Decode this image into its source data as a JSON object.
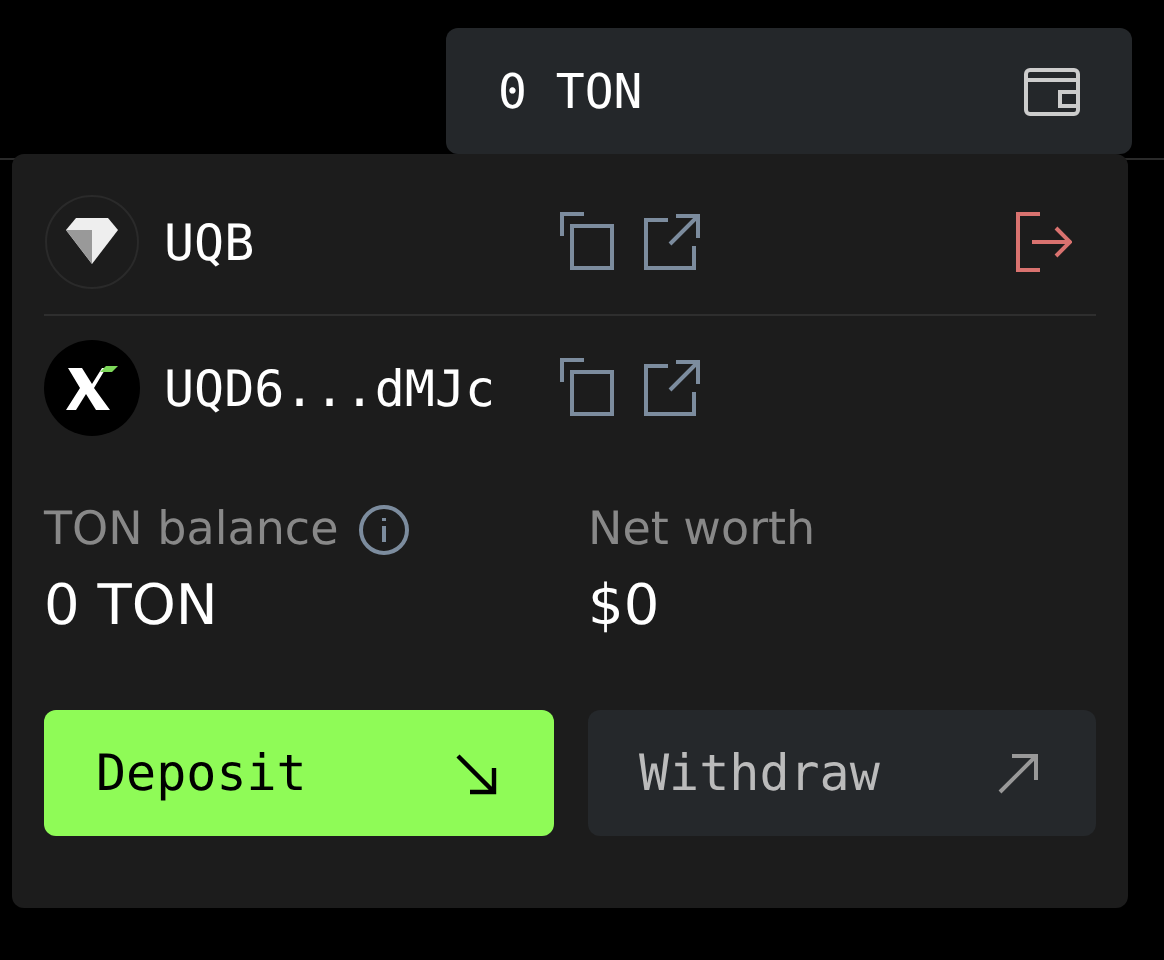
{
  "wallet_button": {
    "label": "0 TON"
  },
  "accounts": [
    {
      "kind": "ton",
      "address": "UQB",
      "logout": true
    },
    {
      "kind": "x",
      "address": "UQD6...dMJc",
      "logout": false
    }
  ],
  "stats": [
    {
      "label": "TON balance",
      "info": true,
      "value": "0 TON"
    },
    {
      "label": "Net worth",
      "info": false,
      "value": "$0"
    }
  ],
  "buttons": [
    {
      "label": "Deposit",
      "kind": "primary"
    },
    {
      "label": "Withdraw",
      "kind": "secondary"
    }
  ]
}
